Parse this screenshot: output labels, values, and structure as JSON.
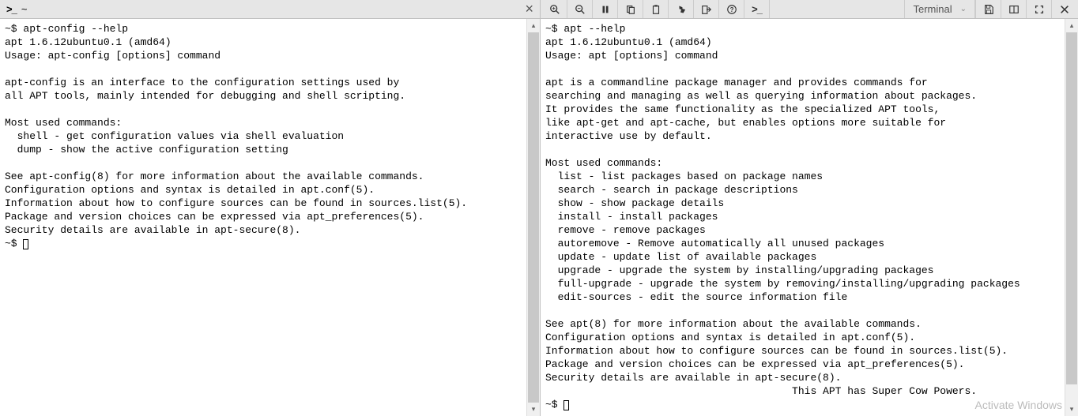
{
  "left": {
    "tab_title": "~",
    "prompt": "~$",
    "command": "apt-config --help",
    "output": "apt 1.6.12ubuntu0.1 (amd64)\nUsage: apt-config [options] command\n\napt-config is an interface to the configuration settings used by\nall APT tools, mainly intended for debugging and shell scripting.\n\nMost used commands:\n  shell - get configuration values via shell evaluation\n  dump - show the active configuration setting\n\nSee apt-config(8) for more information about the available commands.\nConfiguration options and syntax is detailed in apt.conf(5).\nInformation about how to configure sources can be found in sources.list(5).\nPackage and version choices can be expressed via apt_preferences(5).\nSecurity details are available in apt-secure(8).",
    "end_prompt": "~$"
  },
  "right": {
    "dropdown_label": "Terminal",
    "prompt": "~$",
    "command": "apt --help",
    "output": "apt 1.6.12ubuntu0.1 (amd64)\nUsage: apt [options] command\n\napt is a commandline package manager and provides commands for\nsearching and managing as well as querying information about packages.\nIt provides the same functionality as the specialized APT tools,\nlike apt-get and apt-cache, but enables options more suitable for\ninteractive use by default.\n\nMost used commands:\n  list - list packages based on package names\n  search - search in package descriptions\n  show - show package details\n  install - install packages\n  remove - remove packages\n  autoremove - Remove automatically all unused packages\n  update - update list of available packages\n  upgrade - upgrade the system by installing/upgrading packages\n  full-upgrade - upgrade the system by removing/installing/upgrading packages\n  edit-sources - edit the source information file\n\nSee apt(8) for more information about the available commands.\nConfiguration options and syntax is detailed in apt.conf(5).\nInformation about how to configure sources can be found in sources.list(5).\nPackage and version choices can be expressed via apt_preferences(5).\nSecurity details are available in apt-secure(8).\n                                        This APT has Super Cow Powers.",
    "end_prompt": "~$"
  },
  "watermark": "Activate Windows"
}
